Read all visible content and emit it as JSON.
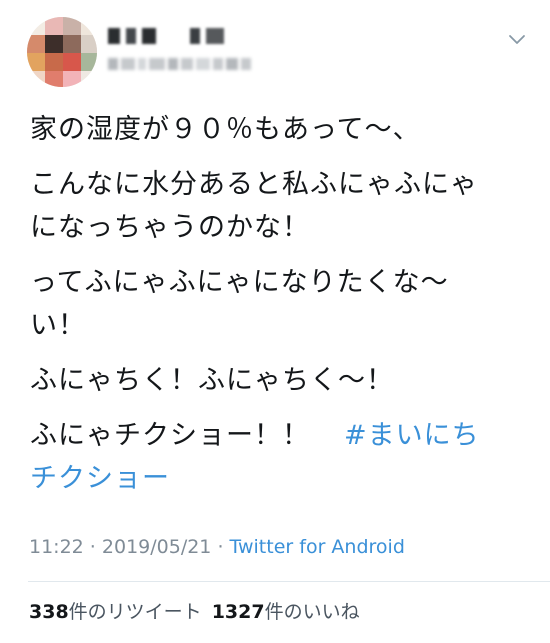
{
  "tweet": {
    "text_lines": [
      "家の湿度が９０％もあって〜、",
      "こんなに水分あると私ふにゃふにゃ",
      "になっちゃうのかな！",
      "ってふにゃふにゃになりたくな〜",
      "い！",
      "ふにゃちく！ふにゃちく〜！",
      "ふにゃチクショー！！"
    ],
    "hashtag_part1": "#まいにち",
    "hashtag_part2": "チクショー"
  },
  "meta": {
    "time": "11:22",
    "sep1": " · ",
    "date": "2019/05/21",
    "sep2": " · ",
    "source": "Twitter for Android"
  },
  "stats": {
    "retweets_count": "338",
    "retweets_label": "件のリツイート",
    "likes_count": "1327",
    "likes_label": "件のいいね"
  },
  "icons": {
    "menu": "chevron-down-icon"
  },
  "colors": {
    "link": "#3a90d8",
    "meta": "#7f8b96",
    "divider": "#e1e8ed"
  }
}
